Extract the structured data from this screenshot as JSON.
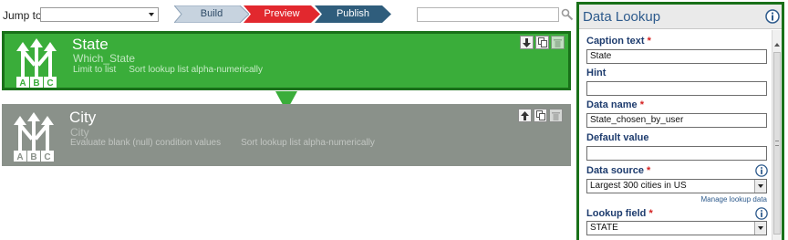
{
  "toolbar": {
    "jump_label": "Jump to",
    "jump_value": "",
    "steps": [
      {
        "label": "Build",
        "color": "#c7d3df",
        "text_color": "#2d4a66"
      },
      {
        "label": "Preview",
        "color": "#e2282e",
        "text_color": "#ffffff"
      },
      {
        "label": "Publish",
        "color": "#2f5d7c",
        "text_color": "#ffffff"
      }
    ],
    "search_value": "",
    "search_icon": "magnifier-icon"
  },
  "blocks": [
    {
      "title": "State",
      "subtitle": "Which_State",
      "meta": [
        "Limit to list",
        "Sort lookup list alpha-numerically"
      ],
      "icon": "lookup-abc-icon",
      "color": "#3aad3a",
      "selected": true,
      "tools": [
        "move-down-icon",
        "copy-icon",
        "delete-icon"
      ]
    },
    {
      "title": "City",
      "subtitle": "City",
      "meta": [
        "Evaluate blank (null) condition values",
        "Sort lookup list alpha-numerically"
      ],
      "icon": "lookup-abc-icon",
      "color": "#8a918a",
      "selected": false,
      "tools": [
        "move-up-icon",
        "copy-icon",
        "delete-icon"
      ]
    }
  ],
  "panel": {
    "title": "Data Lookup",
    "caption_label": "Caption text",
    "caption_value": "State",
    "hint_label": "Hint",
    "hint_value": "",
    "name_label": "Data name",
    "name_value": "State_chosen_by_user",
    "default_label": "Default value",
    "default_value": "",
    "source_label": "Data source",
    "source_value": "Largest 300 cities in US",
    "manage_link": "Manage lookup data",
    "lookup_label": "Lookup field",
    "lookup_value": "STATE",
    "required_mark": "*"
  },
  "colors": {
    "accent": "#197019",
    "selected_block": "#3aad3a",
    "inactive_block": "#8a918a",
    "panel_title": "#2d5a8c"
  }
}
